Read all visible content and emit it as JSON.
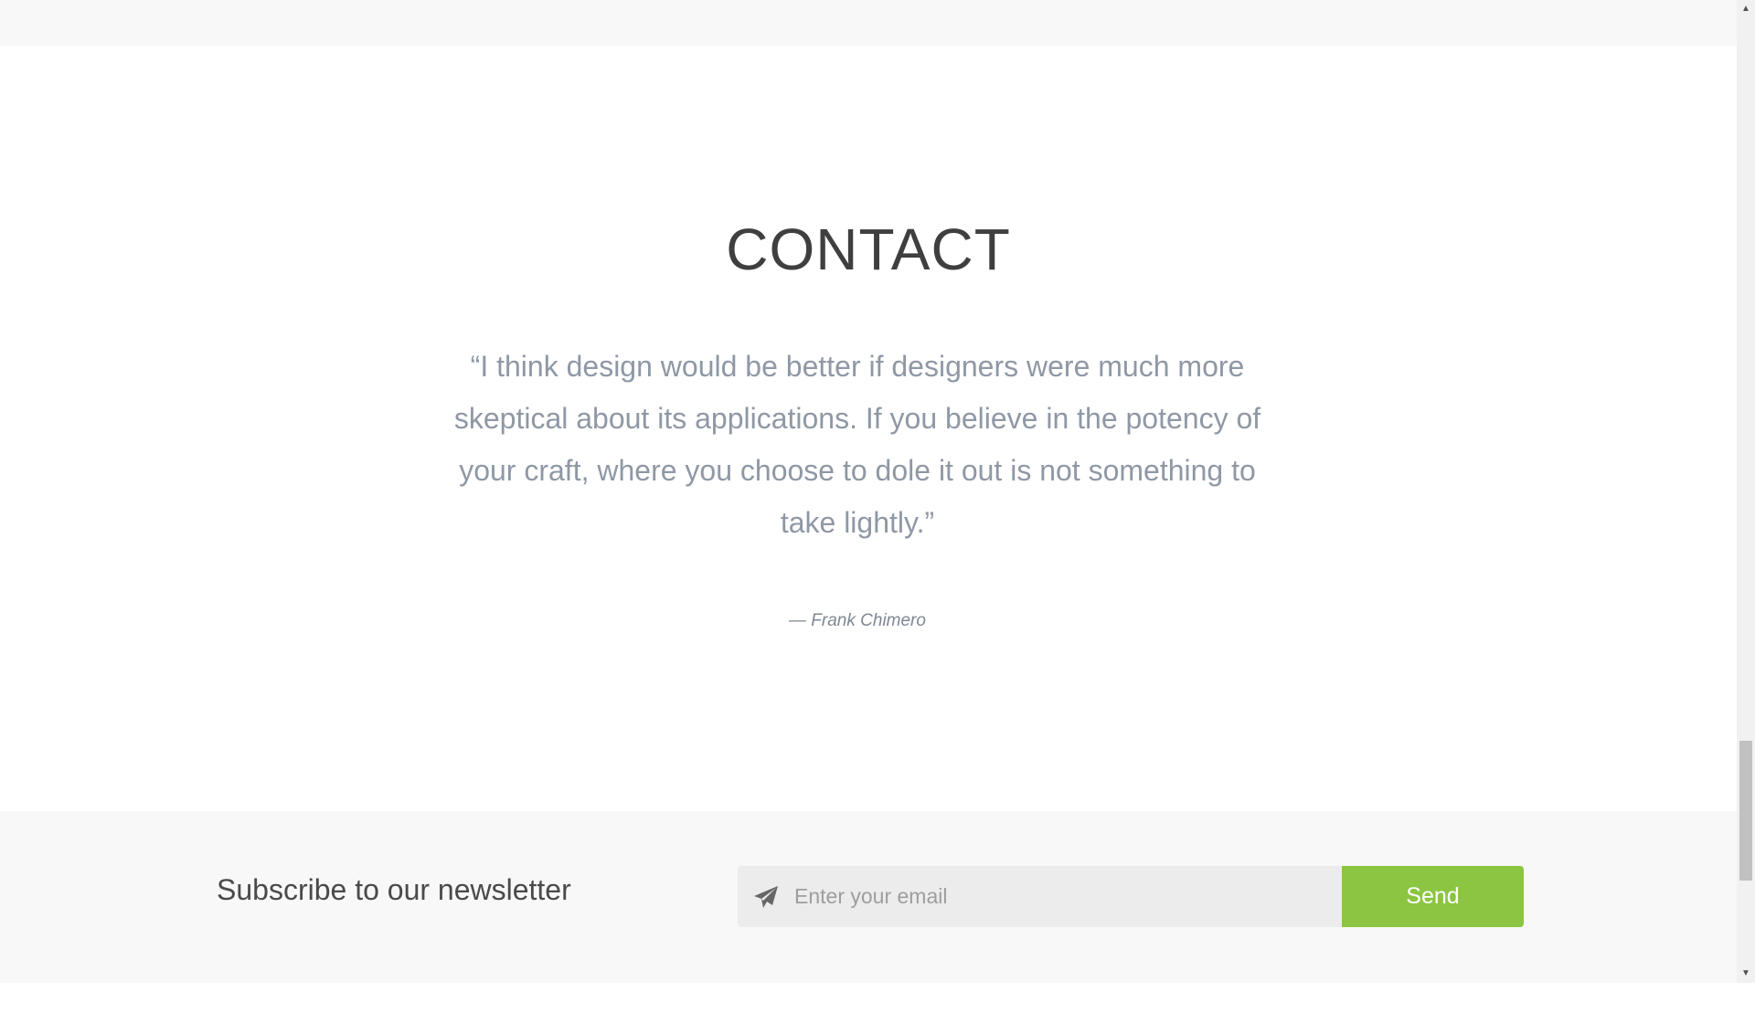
{
  "contact": {
    "title": "CONTACT",
    "quote": "“I think design would be better if designers were much more skeptical about its applications. If you believe in the potency of your craft, where you choose to dole it out is not something to take lightly.”",
    "author": "— Frank Chimero"
  },
  "newsletter": {
    "title": "Subscribe to our newsletter",
    "email_placeholder": "Enter your email",
    "email_value": "",
    "send_label": "Send",
    "icon": "paper-plane-icon"
  },
  "colors": {
    "accent": "#8bc541",
    "section_background": "#f8f8f8",
    "quote_text": "#8f98a5",
    "heading_text": "#3f3f3f"
  },
  "scrollbar": {
    "up_glyph": "▲",
    "down_glyph": "▼"
  }
}
